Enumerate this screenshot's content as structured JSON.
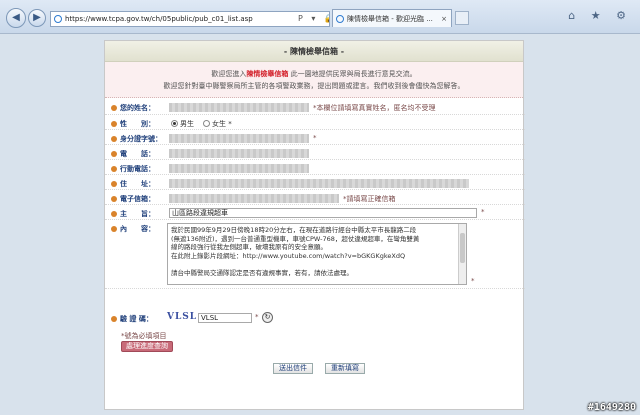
{
  "browser": {
    "url": "https://www.tcpa.gov.tw/ch/05public/pub_c01_list.asp",
    "tab_title": "陳情檢舉信箱 - 歡迎光臨 ...",
    "tab_close": "×",
    "addr_tools": "P ▾ 🔒 C ×",
    "right_icons": "⌂ ★ ⚙"
  },
  "form": {
    "title": "- 陳情檢舉信箱 -",
    "intro_line1_pre": "歡迎您進入",
    "intro_line1_hl": "陳情檢舉信箱",
    "intro_line1_post": "此一園地提供民眾與局長進行意見交流。",
    "intro_line2": "歡迎您針對臺中縣警察局所主管的各項警政業務，提出問題或建言。我們收到後會儘快為您解答。",
    "fields": {
      "name_label": "您的姓名：",
      "name_note": "*本欄位請填寫真實姓名，匿名均不受理",
      "gender_label": "性　　別：",
      "gender_male": "男生",
      "gender_female": "女生",
      "gender_star": "*",
      "id_label": "身分證字號：",
      "id_star": "*",
      "phone_label": "電　　話：",
      "mobile_label": "行動電話：",
      "address_label": "住　　址：",
      "email_label": "電子信箱：",
      "email_note": "*請填寫正確信箱",
      "subject_label": "主　　旨：",
      "subject_value": "山區路段違規超車",
      "subject_star": "*",
      "content_label": "內　　容：",
      "content_lines": [
        "我於民國99年9月29日傍晚18時20分左右，在現在道路行經台中縣太平市長龍路二段",
        "(無遮136附近)，遇到一台普通重型機車，車號CPW-768，超仗違規超車，在彎角雙黃",
        "線的路段強行從我左側超車，破壞我原有的安全意願。",
        "在此附上錄影片段網址：http://www.youtube.com/watch?v=bGKGKgkeXdQ",
        "",
        "請台中縣警局交通隊認定是否有違規事實，若有，請依法處理。"
      ],
      "content_star": "*",
      "captcha_label": "驗 證 碼：",
      "captcha_image_text": "VLSL",
      "captcha_value": "VLSL",
      "captcha_star": "*"
    },
    "required_note": "*號為必填項目",
    "status_button": "處理進度查詢",
    "submit_button": "送出信件",
    "reset_button": "重新填寫"
  },
  "watermark": "#1649280"
}
